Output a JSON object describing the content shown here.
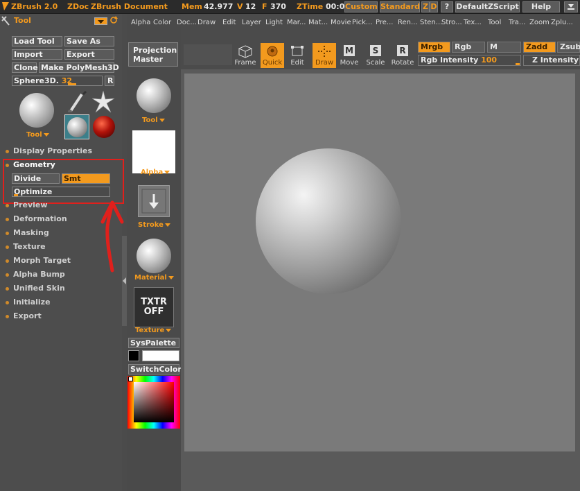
{
  "titlebar": {
    "app": "ZBrush 2.0",
    "doc": "ZDoc",
    "doc_title": "ZBrush Document",
    "mem": "Mem",
    "mem_val": "42.977",
    "v": "V",
    "v_val": "12",
    "f": "F",
    "f_val": "370",
    "ztime": "ZTime",
    "ztime_val": "00:0",
    "custom": "Custom",
    "standard": "Standard",
    "z": "Z",
    "d": "D",
    "q": "?",
    "script": "DefaultZScript",
    "help": "Help"
  },
  "left": {
    "tool_label": "Tool",
    "load": "Load Tool",
    "saveas": "Save As",
    "import": "Import",
    "export": "Export",
    "clone": "Clone",
    "make": "Make PolyMesh3D",
    "sphere_name": "Sphere3D.",
    "sphere_num": "32",
    "r": "R",
    "tool_caption": "Tool",
    "menu": [
      "Display Properties",
      "Geometry",
      "Preview",
      "Deformation",
      "Masking",
      "Texture",
      "Morph Target",
      "Alpha Bump",
      "Unified Skin",
      "Initialize",
      "Export"
    ],
    "divide": "Divide",
    "smt": "Smt",
    "optimize": "Optimize"
  },
  "mid": {
    "tool": "Tool",
    "alpha": "Alpha",
    "stroke": "Stroke",
    "material": "Material",
    "txtr1": "TXTR",
    "txtr2": "OFF",
    "texture": "Texture",
    "syspalette": "SysPalette",
    "switchcolor": "SwitchColor"
  },
  "topmenu": [
    "Alpha",
    "Color",
    "Doc...",
    "Draw",
    "Edit",
    "Layer",
    "Light",
    "Mar...",
    "Mat...",
    "Movie",
    "Pick...",
    "Pre...",
    "Ren...",
    "Sten...",
    "Stro...",
    "Tex...",
    "Tool",
    "Tra...",
    "Zoom",
    "Zplu..."
  ],
  "toolbar": {
    "projection1": "Projection",
    "projection2": "Master",
    "frame": "Frame",
    "quick": "Quick",
    "edit": "Edit",
    "draw": "Draw",
    "move": "Move",
    "scale": "Scale",
    "rotate": "Rotate",
    "mrgb": "Mrgb",
    "rgb": "Rgb",
    "m": "M",
    "zadd": "Zadd",
    "zsub": "Zsub",
    "rgb_intensity": "Rgb Intensity",
    "rgb_intensity_val": "100",
    "z_intensity": "Z Intensity"
  },
  "colors": {
    "accent": "#f39a1e",
    "highlight_box": "#e0201c",
    "arrow": "#e0201c"
  }
}
